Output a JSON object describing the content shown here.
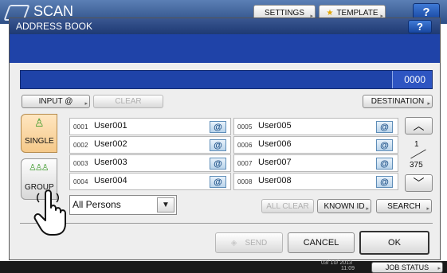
{
  "top_bar": {
    "title": "SCAN",
    "settings_label": "SETTINGS",
    "template_label": "TEMPLATE",
    "help_label": "?"
  },
  "dialog": {
    "title": "ADDRESS BOOK",
    "help_label": "?",
    "count": "0000",
    "input_label": "INPUT @",
    "clear_label": "CLEAR",
    "destination_label": "DESTINATION"
  },
  "tabs": [
    {
      "label": "SINGLE",
      "icon": "person-icon"
    },
    {
      "label": "GROUP",
      "icon": "group-icon"
    }
  ],
  "entries": [
    {
      "num": "0001",
      "name": "User001"
    },
    {
      "num": "0002",
      "name": "User002"
    },
    {
      "num": "0003",
      "name": "User003"
    },
    {
      "num": "0004",
      "name": "User004"
    },
    {
      "num": "0005",
      "name": "User005"
    },
    {
      "num": "0006",
      "name": "User006"
    },
    {
      "num": "0007",
      "name": "User007"
    },
    {
      "num": "0008",
      "name": "User008"
    }
  ],
  "mail_icon_label": "@",
  "pager": {
    "current": "1",
    "total": "375"
  },
  "filter": {
    "selected": "All Persons"
  },
  "actions": {
    "all_clear": "ALL CLEAR",
    "known_id": "KNOWN ID",
    "search": "SEARCH",
    "send": "SEND",
    "cancel": "CANCEL",
    "ok": "OK"
  },
  "status": {
    "date": "03/ 10/ 2013",
    "time": "11:09",
    "job_status": "JOB STATUS"
  },
  "colors": {
    "accent_blue": "#1f43a8",
    "header_navy": "#1e3a8a",
    "status_bar": "#1a1a1a"
  }
}
